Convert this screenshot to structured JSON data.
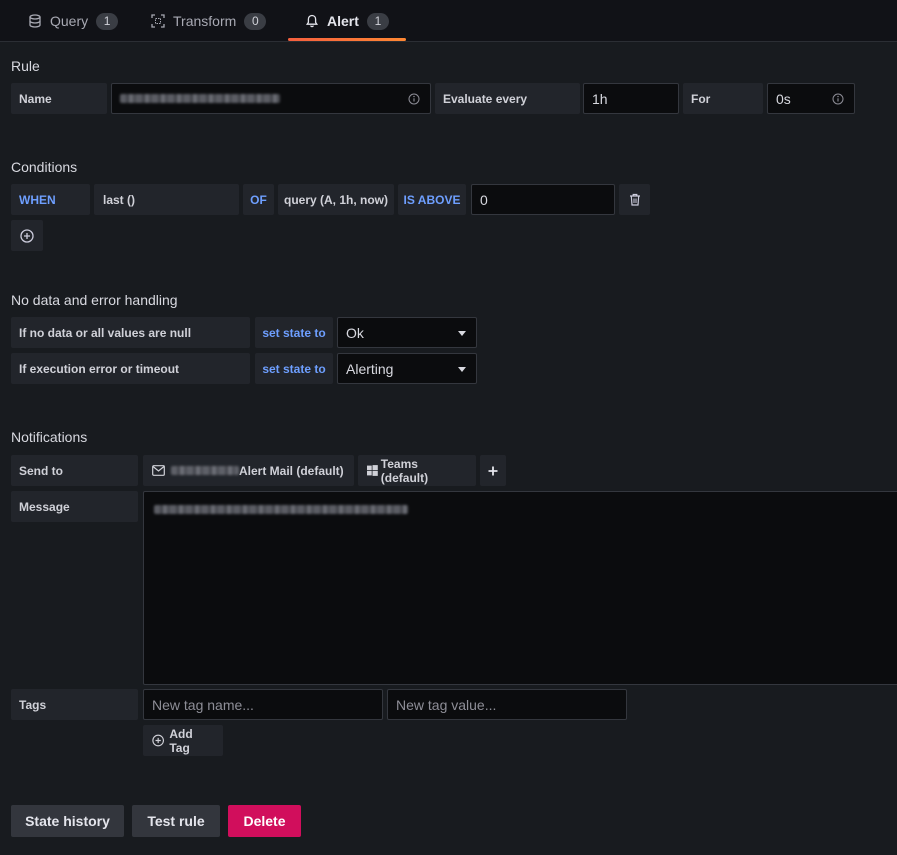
{
  "tabs": [
    {
      "label": "Query",
      "count": "1",
      "icon": "database-icon"
    },
    {
      "label": "Transform",
      "count": "0",
      "icon": "transform-icon"
    },
    {
      "label": "Alert",
      "count": "1",
      "icon": "bell-icon",
      "active": true
    }
  ],
  "rule": {
    "section_title": "Rule",
    "name_label": "Name",
    "evaluate_label": "Evaluate every",
    "evaluate_value": "1h",
    "for_label": "For",
    "for_value": "0s"
  },
  "conditions": {
    "section_title": "Conditions",
    "when": "WHEN",
    "reducer": "last ()",
    "of": "OF",
    "query": "query (A, 1h, now)",
    "evaluator": "IS ABOVE",
    "threshold": "0"
  },
  "no_data": {
    "section_title": "No data and error handling",
    "rows": [
      {
        "label": "If no data or all values are null",
        "action": "set state to",
        "value": "Ok"
      },
      {
        "label": "If execution error or timeout",
        "action": "set state to",
        "value": "Alerting"
      }
    ]
  },
  "notifications": {
    "section_title": "Notifications",
    "send_to_label": "Send to",
    "channels": [
      {
        "label": "Alert Mail (default)",
        "icon": "mail-icon"
      },
      {
        "label": "Teams (default)",
        "icon": "windows-icon"
      }
    ],
    "message_label": "Message",
    "tags_label": "Tags",
    "tag_name_placeholder": "New tag name...",
    "tag_value_placeholder": "New tag value...",
    "add_tag_label": "Add Tag"
  },
  "footer": {
    "state_history": "State history",
    "test_rule": "Test rule",
    "delete": "Delete"
  },
  "colors": {
    "accent_blue": "#6e9fff",
    "danger": "#d10e5c",
    "tab_underline": "#ff7a33"
  }
}
